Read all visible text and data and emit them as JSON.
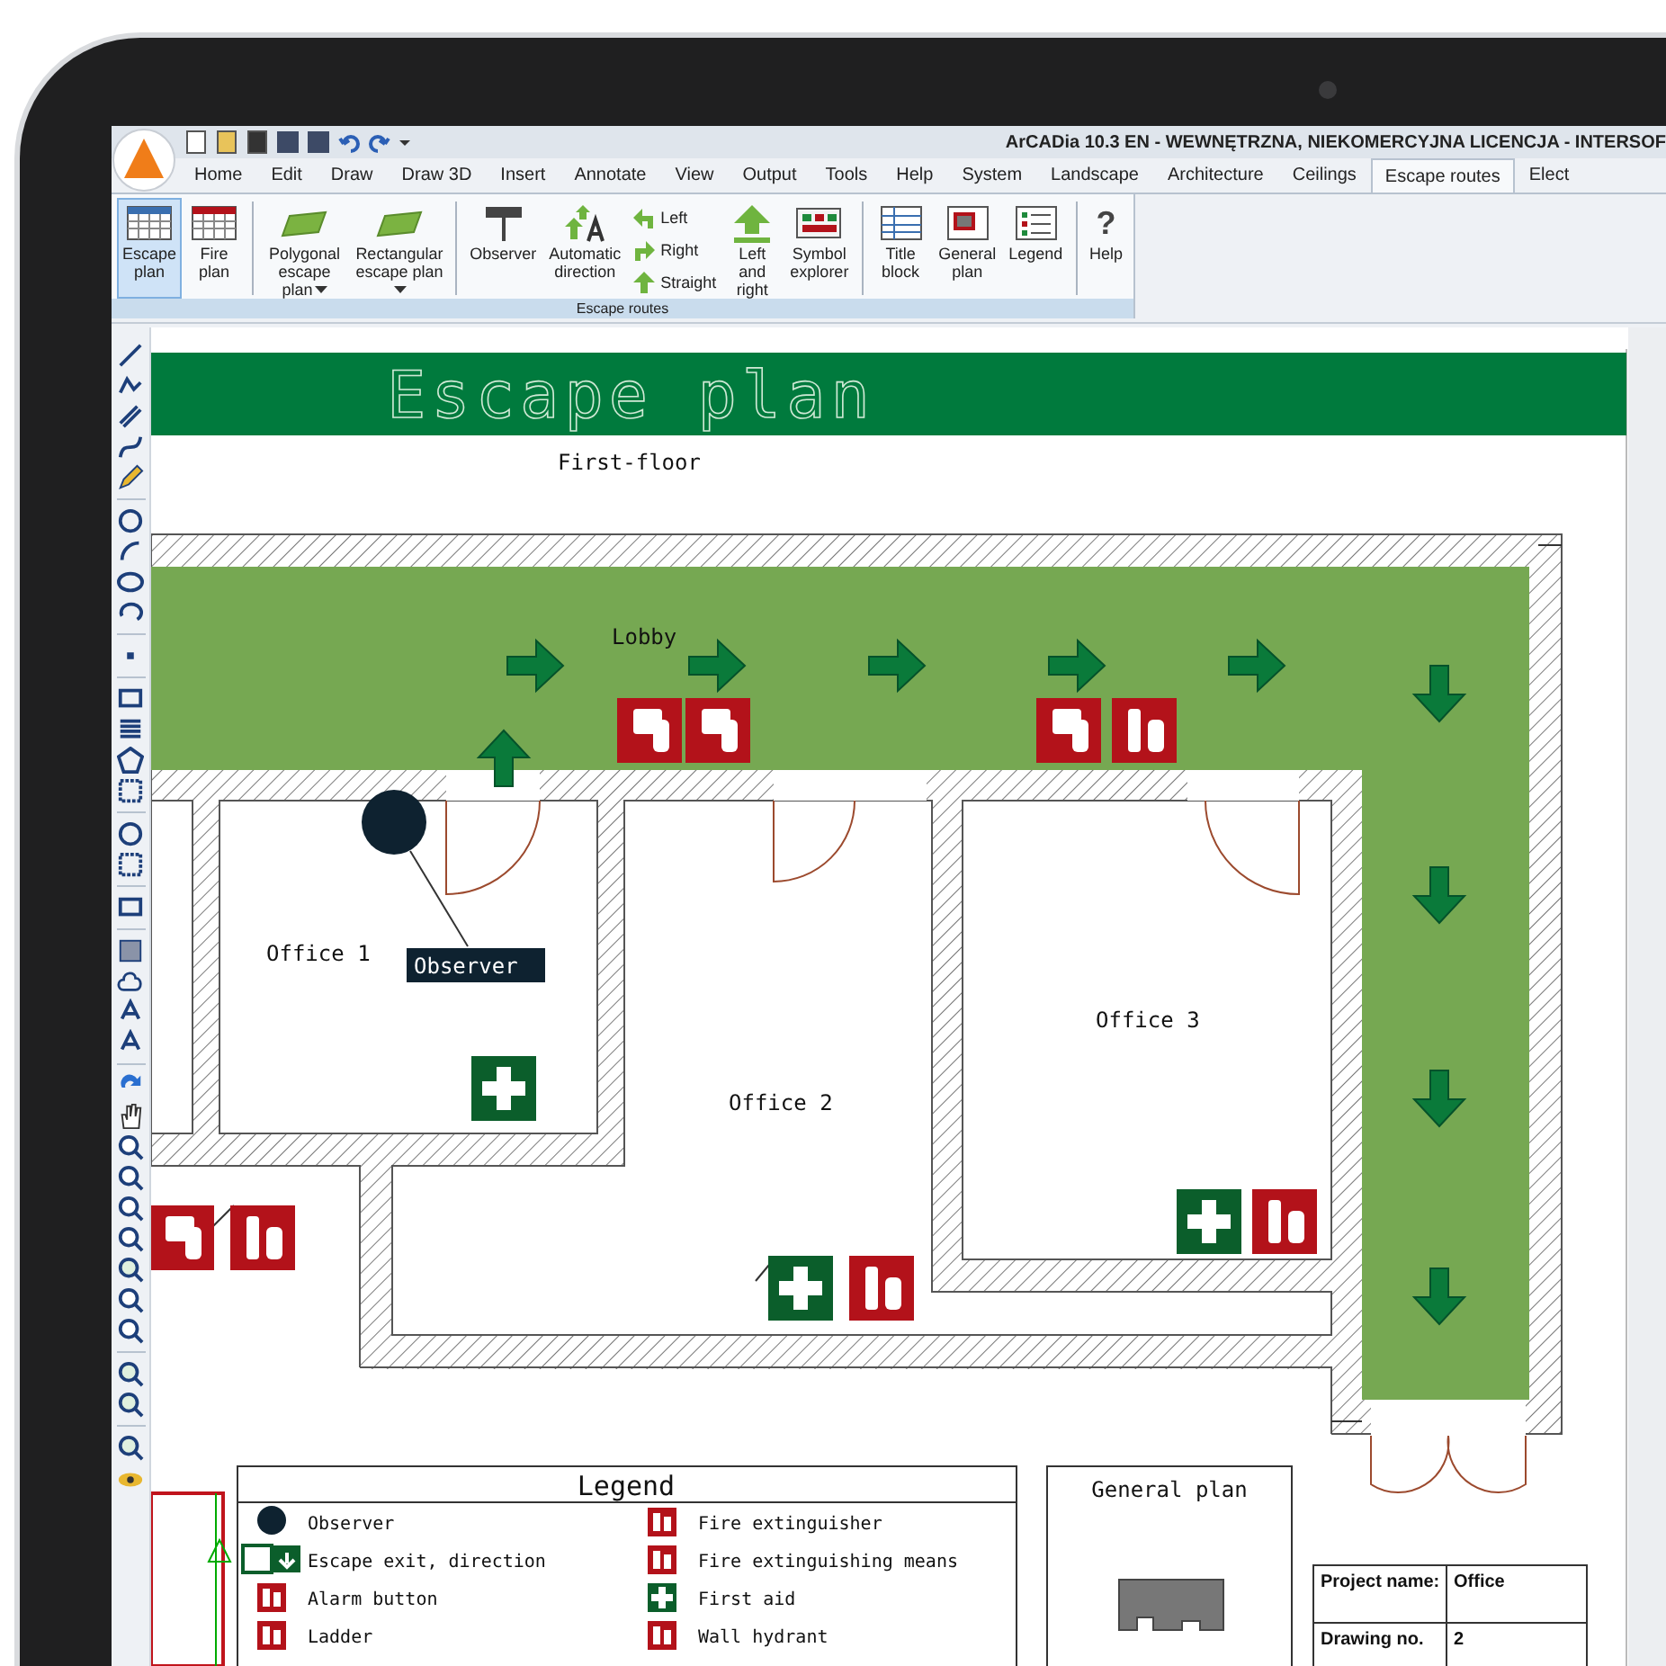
{
  "window": {
    "title": "ArCADia 10.3 EN - WEWNĘTRZNA, NIEKOMERCYJNA LICENCJA - INTERSOF"
  },
  "tabs": [
    {
      "label": "Home",
      "selected": false
    },
    {
      "label": "Edit",
      "selected": false
    },
    {
      "label": "Draw",
      "selected": false
    },
    {
      "label": "Draw 3D",
      "selected": false
    },
    {
      "label": "Insert",
      "selected": false
    },
    {
      "label": "Annotate",
      "selected": false
    },
    {
      "label": "View",
      "selected": false
    },
    {
      "label": "Output",
      "selected": false
    },
    {
      "label": "Tools",
      "selected": false
    },
    {
      "label": "Help",
      "selected": false
    },
    {
      "label": "System",
      "selected": false
    },
    {
      "label": "Landscape",
      "selected": false
    },
    {
      "label": "Architecture",
      "selected": false
    },
    {
      "label": "Ceilings",
      "selected": false
    },
    {
      "label": "Escape routes",
      "selected": true
    },
    {
      "label": "Elect",
      "selected": false
    }
  ],
  "ribbon": {
    "group_label": "Escape routes",
    "items": [
      {
        "kind": "large",
        "label": "Escape plan",
        "selected": true
      },
      {
        "kind": "large",
        "label": "Fire plan",
        "selected": false
      },
      {
        "kind": "large",
        "label": "Polygonal escape plan",
        "dropdown": true,
        "selected": false,
        "separator_before": true
      },
      {
        "kind": "large",
        "label": "Rectangular escape plan",
        "dropdown": true,
        "selected": false
      },
      {
        "kind": "large",
        "label": "Observer",
        "selected": false,
        "separator_before": true
      },
      {
        "kind": "large",
        "label": "Automatic direction",
        "selected": false
      },
      {
        "kind": "stack",
        "buttons": [
          {
            "label": "Left"
          },
          {
            "label": "Right"
          },
          {
            "label": "Straight"
          }
        ]
      },
      {
        "kind": "large",
        "label": "Left and right",
        "selected": false
      },
      {
        "kind": "large",
        "label": "Symbol explorer",
        "selected": false
      },
      {
        "kind": "large",
        "label": "Title block",
        "selected": false,
        "separator_before": true
      },
      {
        "kind": "large",
        "label": "General plan",
        "selected": false
      },
      {
        "kind": "large",
        "label": "Legend",
        "selected": false
      },
      {
        "kind": "large",
        "label": "Help",
        "icon_text": "?",
        "selected": false,
        "separator_before": true
      }
    ]
  },
  "drawing": {
    "title": "Escape plan",
    "subtitle": "First-floor",
    "rooms": [
      "Lobby",
      "Office 1",
      "Office 2",
      "Office 3"
    ],
    "observer_label": "Observer"
  },
  "legend": {
    "title": "Legend",
    "columns": [
      [
        {
          "kind": "observer",
          "label": "Observer"
        },
        {
          "kind": "exit",
          "label": "Escape exit, direction"
        },
        {
          "kind": "alarm",
          "label": "Alarm button"
        },
        {
          "kind": "ladder",
          "label": "Ladder"
        }
      ],
      [
        {
          "kind": "extinguisher",
          "label": "Fire extinguisher"
        },
        {
          "kind": "means",
          "label": "Fire extinguishing means"
        },
        {
          "kind": "first_aid",
          "label": "First aid"
        },
        {
          "kind": "hydrant",
          "label": "Wall hydrant"
        }
      ]
    ]
  },
  "general_plan": {
    "title": "General plan"
  },
  "title_block": {
    "rows": [
      {
        "label": "Project name:",
        "value": "Office"
      },
      {
        "label": "Drawing no.",
        "value": "2"
      }
    ]
  }
}
